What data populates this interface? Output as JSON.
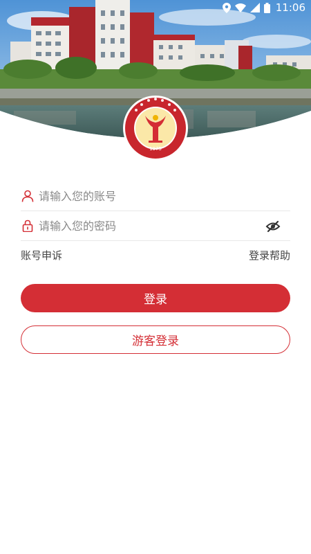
{
  "status_bar": {
    "time": "11:06",
    "icons": [
      "location-icon",
      "wifi-icon",
      "signal-icon",
      "battery-icon"
    ]
  },
  "hero": {
    "image": "campus-photo",
    "logo": {
      "name": "school-emblem",
      "year": "1975"
    }
  },
  "login_form": {
    "account_placeholder": "请输入您的账号",
    "account_value": "",
    "password_placeholder": "请输入您的密码",
    "password_value": ""
  },
  "links": {
    "account_appeal": "账号申诉",
    "login_help": "登录帮助"
  },
  "buttons": {
    "login": "登录",
    "guest_login": "游客登录"
  },
  "colors": {
    "accent": "#d42e35",
    "sky": "#6aa9e0",
    "text_muted": "#8a8a8a"
  }
}
